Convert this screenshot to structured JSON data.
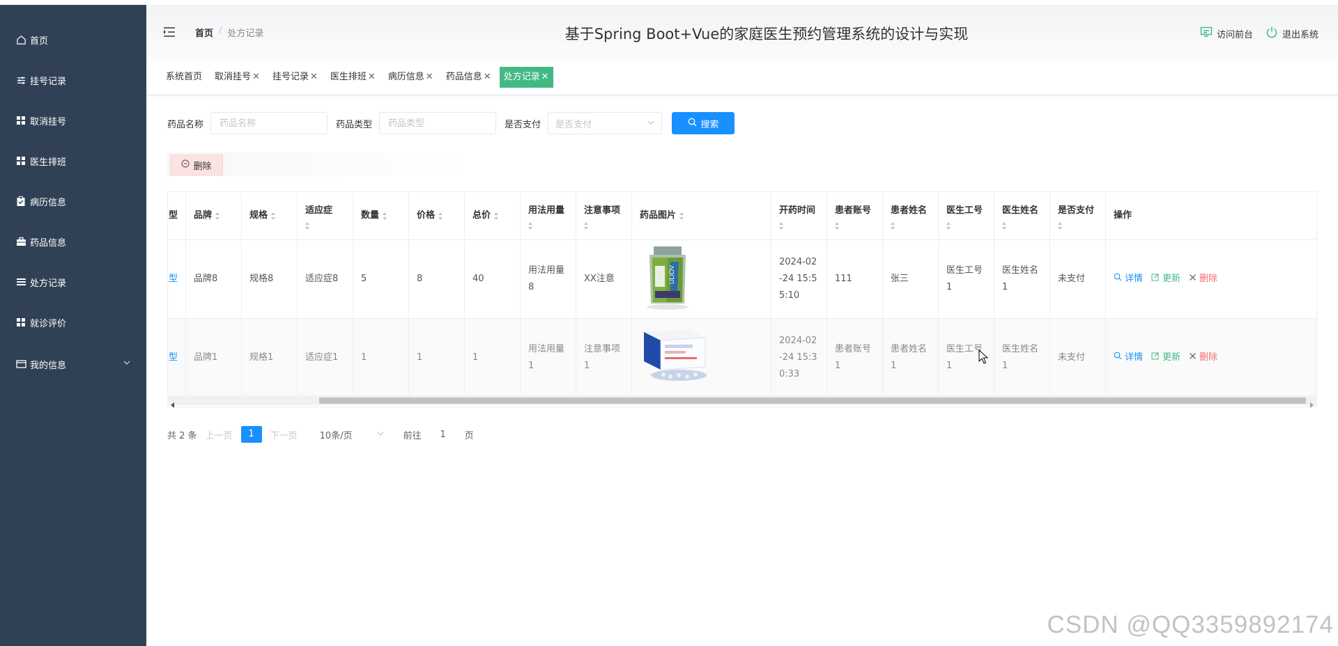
{
  "sidebar": {
    "items": [
      {
        "label": "首页",
        "icon": "home-icon"
      },
      {
        "label": "挂号记录",
        "icon": "sliders-icon"
      },
      {
        "label": "取消挂号",
        "icon": "grid-icon"
      },
      {
        "label": "医生排班",
        "icon": "grid-icon"
      },
      {
        "label": "病历信息",
        "icon": "clipboard-icon"
      },
      {
        "label": "药品信息",
        "icon": "briefcase-icon"
      },
      {
        "label": "处方记录",
        "icon": "list-icon"
      },
      {
        "label": "就诊评价",
        "icon": "grid-icon"
      },
      {
        "label": "我的信息",
        "icon": "card-icon"
      }
    ]
  },
  "header": {
    "breadcrumb": {
      "home": "首页",
      "separator": "/",
      "current": "处方记录"
    },
    "title": "基于Spring Boot+Vue的家庭医生预约管理系统的设计与实现",
    "visit_front": "访问前台",
    "logout": "退出系统"
  },
  "tags": [
    {
      "label": "系统首页",
      "closable": false
    },
    {
      "label": "取消挂号",
      "closable": true
    },
    {
      "label": "挂号记录",
      "closable": true
    },
    {
      "label": "医生排班",
      "closable": true
    },
    {
      "label": "病历信息",
      "closable": true
    },
    {
      "label": "药品信息",
      "closable": true
    },
    {
      "label": "处方记录",
      "closable": true,
      "active": true
    }
  ],
  "tag_close": "✕",
  "search": {
    "drug_name_label": "药品名称",
    "drug_name_placeholder": "药品名称",
    "drug_type_label": "药品类型",
    "drug_type_placeholder": "药品类型",
    "paid_label": "是否支付",
    "paid_placeholder": "是否支付",
    "search_button": "搜索"
  },
  "delete_button": "删除",
  "table": {
    "columns": [
      "型",
      "品牌",
      "规格",
      "适应症",
      "数量",
      "价格",
      "总价",
      "用法用量",
      "注意事项",
      "药品图片",
      "开药时间",
      "患者账号",
      "患者姓名",
      "医生工号",
      "医生姓名",
      "是否支付",
      "操作"
    ],
    "rows": [
      {
        "type": "型",
        "brand": "品牌8",
        "spec": "规格8",
        "indication": "适应症8",
        "qty": "5",
        "price": "8",
        "total": "40",
        "usage": [
          "用法用量",
          "8"
        ],
        "notes": [
          "XX注意"
        ],
        "time": [
          "2024-02",
          "-24 15:5",
          "5:10"
        ],
        "account": [
          "111"
        ],
        "patient": [
          "张三"
        ],
        "doctor_id": [
          "医生工号",
          "1"
        ],
        "doctor_name": [
          "医生姓名",
          "1"
        ],
        "paid": "未支付"
      },
      {
        "type": "型",
        "brand": "品牌1",
        "spec": "规格1",
        "indication": "适应症1",
        "qty": "1",
        "price": "1",
        "total": "1",
        "usage": [
          "用法用量",
          "1"
        ],
        "notes": [
          "注意事项",
          "1"
        ],
        "time": [
          "2024-02",
          "-24 15:3",
          "0:33"
        ],
        "account": [
          "患者账号",
          "1"
        ],
        "patient": [
          "患者姓名",
          "1"
        ],
        "doctor_id": [
          "医生工号",
          "1"
        ],
        "doctor_name": [
          "医生姓名",
          "1"
        ],
        "paid": "未支付"
      }
    ],
    "actions": {
      "detail": "详情",
      "update": "更新",
      "delete": "删除"
    }
  },
  "pagination": {
    "total": "共 2 条",
    "prev": "上一页",
    "page": "1",
    "next": "下一页",
    "size": "10条/页",
    "goto": "前往",
    "goto_value": "1",
    "page_unit": "页"
  },
  "watermark": "CSDN @QQ3359892174",
  "colors": {
    "sidebar": "#304156",
    "active_tag": "#42b983",
    "primary": "#1890ff",
    "danger": "#f56c6c"
  }
}
